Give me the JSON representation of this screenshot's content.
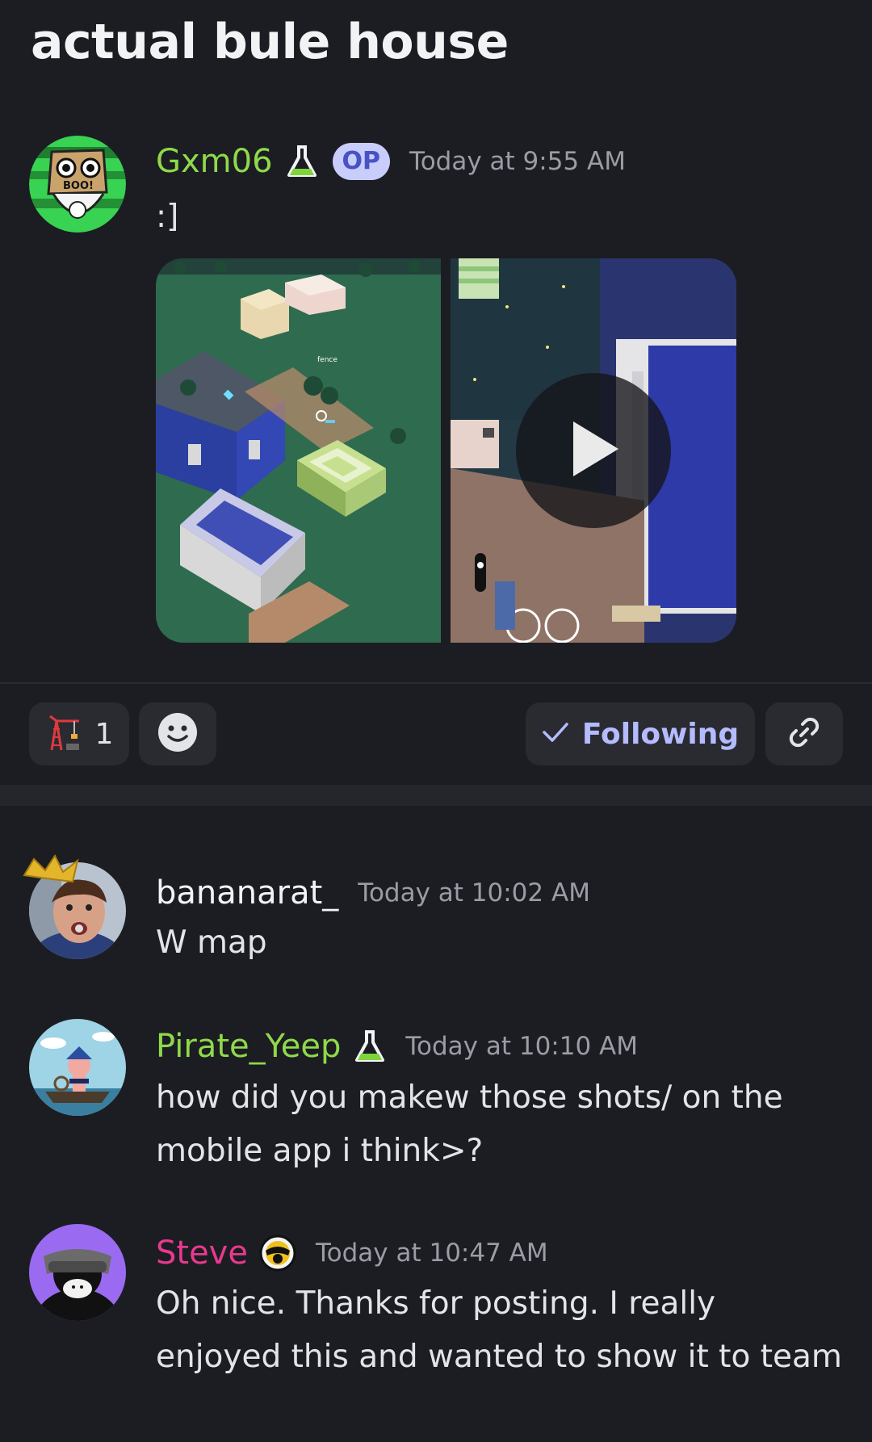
{
  "thread": {
    "title": "actual bule house"
  },
  "op_message": {
    "username": "Gxm06",
    "username_color": "#8fd94a",
    "badge": "OP",
    "timestamp": "Today at 9:55 AM",
    "text": ":]",
    "attachments": [
      {
        "kind": "image",
        "icon": "image-thumbnail"
      },
      {
        "kind": "video",
        "icon": "play-icon"
      }
    ]
  },
  "actions": {
    "reaction_icon": "crane-emoji",
    "reaction_count": "1",
    "add_reaction_icon": "smiley-icon",
    "follow_label": "Following",
    "follow_icon": "check-icon",
    "link_icon": "link-icon",
    "accent": "#b4bcff"
  },
  "replies": [
    {
      "username": "bananarat_",
      "username_color": "#f2f3f5",
      "timestamp": "Today at 10:02 AM",
      "text": "W map"
    },
    {
      "username": "Pirate_Yeep",
      "username_color": "#8fd94a",
      "timestamp": "Today at 10:10 AM",
      "text": "how did you makew those shots/ on the mobile app i think>?"
    },
    {
      "username": "Steve",
      "username_color": "#e8398e",
      "timestamp": "Today at 10:47 AM",
      "text": "Oh nice. Thanks for posting. I really enjoyed this and wanted to show it to team"
    }
  ]
}
